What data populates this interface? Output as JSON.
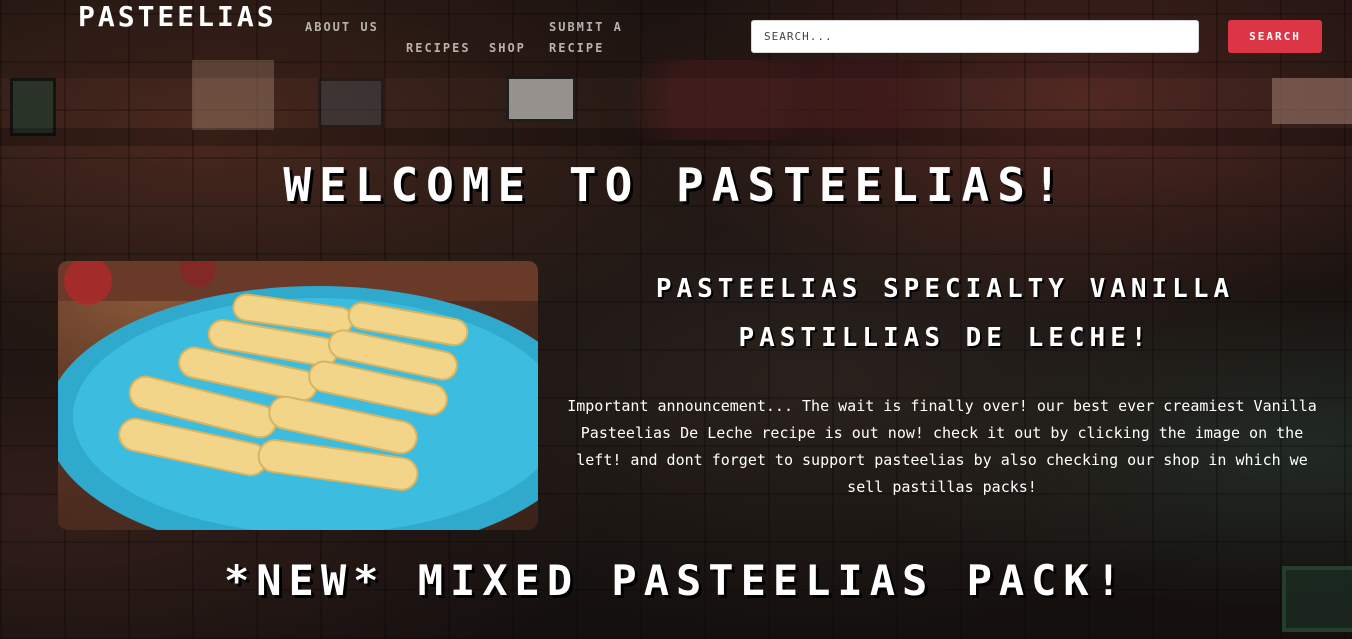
{
  "nav": {
    "brand": "PASTEELIAS",
    "links": [
      {
        "label": "ABOUT US"
      },
      {
        "label": "RECIPES"
      },
      {
        "label": "SHOP"
      },
      {
        "label": "SUBMIT A RECIPE"
      }
    ],
    "search": {
      "placeholder": "SEARCH...",
      "button_label": "SEARCH"
    }
  },
  "main": {
    "welcome": "WELCOME TO PASTEELIAS!",
    "featured": {
      "title": "PASTEELIAS SPECIALTY VANILLA PASTILLIAS DE LECHE!",
      "announcement": "Important announcement... The wait is finally over! our best ever creamiest Vanilla Pasteelias De Leche recipe is out now! check it out by clicking the image on the left! and dont forget to support pasteelias by also checking our shop in which we sell pastillas packs!"
    },
    "new_pack_heading": "*NEW* MIXED PASTEELIAS PACK!"
  },
  "colors": {
    "accent": "#dc3545",
    "plate": "#35b6d8",
    "pastillas": "#f3d58a"
  }
}
